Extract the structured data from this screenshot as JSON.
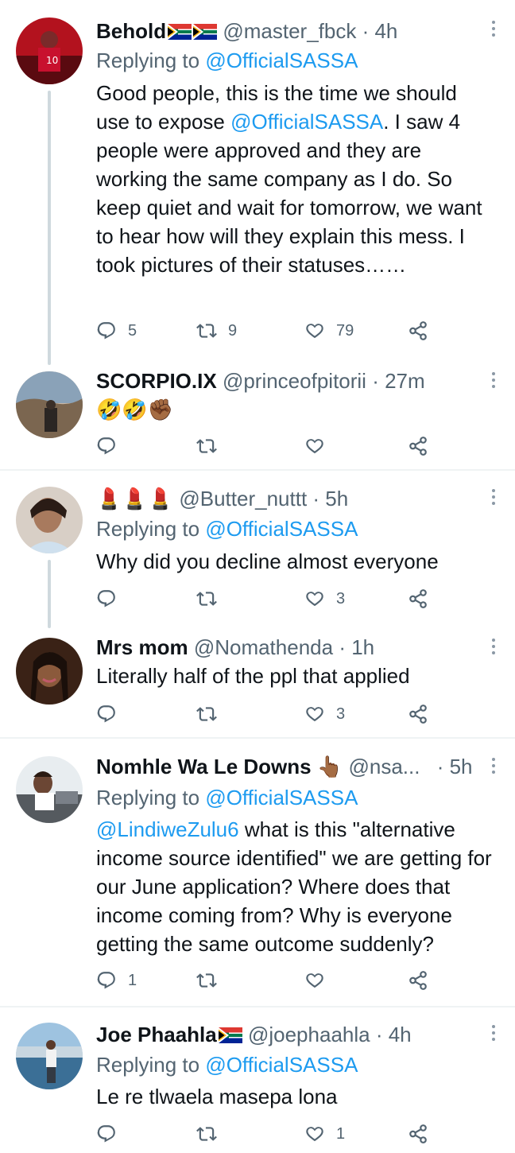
{
  "colors": {
    "link": "#1d9bf0",
    "muted": "#536471",
    "text": "#0f1419",
    "divider": "#eff3f4"
  },
  "icons": {
    "reply": "reply-icon",
    "retweet": "retweet-icon",
    "like": "heart-icon",
    "share": "share-icon",
    "more": "more-icon"
  },
  "tweets": [
    {
      "name": "Behold",
      "handle": "@master_fbck",
      "time": "· 4h",
      "reply_label": "Replying to",
      "reply_handle": "@OfficialSASSA",
      "body_pre": "Good people, this is the time we should use to expose ",
      "body_link": "@OfficialSASSA",
      "body_post": ". I saw 4 people were approved and they are working the same company as I do. So keep quiet and wait for tomorrow, we want to hear how will they explain this mess. I took pictures of their statuses……",
      "replies": "5",
      "retweets": "9",
      "likes": "79"
    },
    {
      "name": "SCORPIO.IX",
      "handle": "@princeofpitorii",
      "time": "· 27m",
      "body": "🤣🤣✊🏾",
      "replies": "",
      "retweets": "",
      "likes": ""
    },
    {
      "name": "💄💄💄",
      "handle": "@Butter_nuttt",
      "time": "· 5h",
      "reply_label": "Replying to",
      "reply_handle": "@OfficialSASSA",
      "body": "Why did you decline almost everyone",
      "replies": "",
      "retweets": "",
      "likes": "3"
    },
    {
      "name": "Mrs mom",
      "handle": "@Nomathenda",
      "time": "· 1h",
      "body": "Literally half of the ppl that applied",
      "replies": "",
      "retweets": "",
      "likes": "3"
    },
    {
      "name": "Nomhle Wa Le Downs",
      "name_emoji": "👆🏾",
      "handle": "@nsa...",
      "time": "· 5h",
      "reply_label": "Replying to",
      "reply_handle": "@OfficialSASSA",
      "body_link": "@LindiweZulu6",
      "body_post": " what is this \"alternative income source identified\" we are getting for our June application? Where does that income coming from? Why is everyone getting the same outcome suddenly?",
      "replies": "1",
      "retweets": "",
      "likes": ""
    },
    {
      "name": "Joe Phaahla",
      "handle": "@joephaahla",
      "time": "· 4h",
      "reply_label": "Replying to",
      "reply_handle": "@OfficialSASSA",
      "body": "Le re tlwaela masepa lona",
      "replies": "",
      "retweets": "",
      "likes": "1"
    }
  ]
}
